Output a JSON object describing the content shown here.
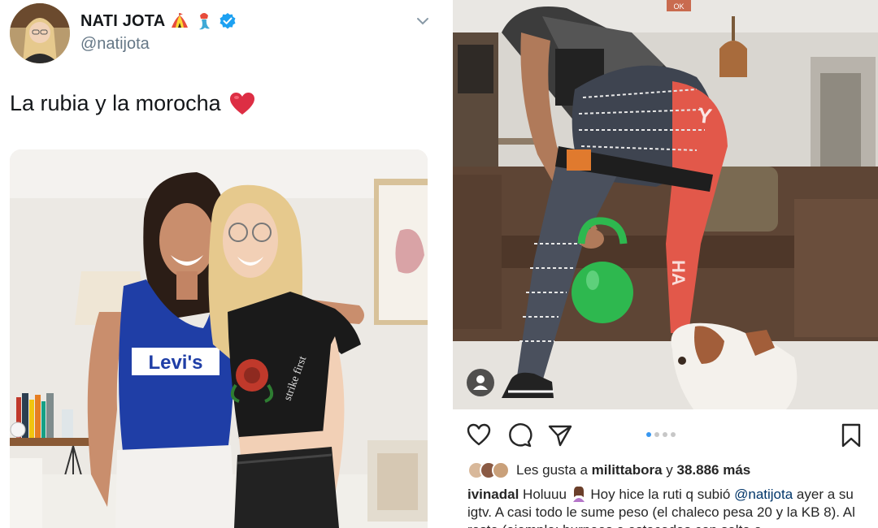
{
  "tweet": {
    "display_name": "NATI JOTA",
    "handle": "@natijota",
    "text": "La rubia y la morocha",
    "photo_shirt_text": "Levi's",
    "photo_tee_text": "strike first"
  },
  "instagram": {
    "carousel": {
      "total": 4,
      "active": 1
    },
    "likes": {
      "prefix": "Les gusta a",
      "user": "milittabora",
      "connector": "y",
      "count": "38.886 más"
    },
    "caption": {
      "username": "ivinadal",
      "text_1": "Holuuu",
      "text_2": "Hoy hice la ruti q subió",
      "mention": "@natijota",
      "text_3": "ayer a su igtv. A casi todo le sume peso (el chaleco pesa 20 y la KB 8). Al resto (ejemplo: burpees o estocadas con salto o"
    },
    "colors": {
      "kettlebell": "#2eb84f",
      "link": "#003569",
      "dot_active": "#3897f0"
    }
  }
}
